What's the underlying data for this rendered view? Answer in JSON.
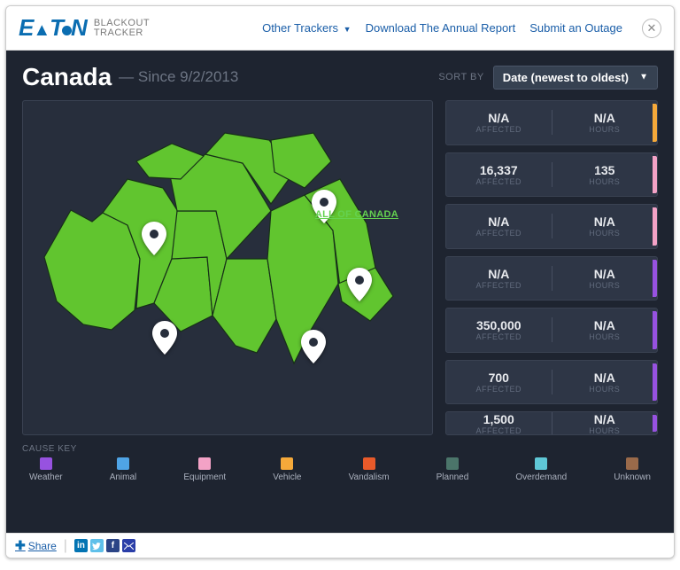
{
  "logo": {
    "brand": "E·T·N",
    "sub_l1": "BLACKOUT",
    "sub_l2": "TRACKER"
  },
  "top_nav": {
    "other_trackers": "Other Trackers",
    "download_report": "Download The Annual Report",
    "submit_outage": "Submit an Outage"
  },
  "page": {
    "title": "Canada",
    "since": "— Since 9/2/2013",
    "all_of_canada": "ALL OF CANADA"
  },
  "sort": {
    "label": "SORT BY",
    "selected": "Date (newest to oldest)"
  },
  "stats": [
    {
      "affected": "N/A",
      "hours": "N/A",
      "color": "#f5a93a"
    },
    {
      "affected": "16,337",
      "hours": "135",
      "color": "#f3a2c6"
    },
    {
      "affected": "N/A",
      "hours": "N/A",
      "color": "#f3a2c6"
    },
    {
      "affected": "N/A",
      "hours": "N/A",
      "color": "#9752e0"
    },
    {
      "affected": "350,000",
      "hours": "N/A",
      "color": "#9752e0"
    },
    {
      "affected": "700",
      "hours": "N/A",
      "color": "#9752e0"
    },
    {
      "affected": "1,500",
      "hours": "N/A",
      "color": "#9752e0"
    }
  ],
  "stat_labels": {
    "affected": "AFFECTED",
    "hours": "HOURS"
  },
  "cause_key": {
    "title": "CAUSE KEY",
    "items": [
      {
        "name": "Weather",
        "color": "#9752e0"
      },
      {
        "name": "Animal",
        "color": "#4fa4e6"
      },
      {
        "name": "Equipment",
        "color": "#f3a2c6"
      },
      {
        "name": "Vehicle",
        "color": "#f5a93a"
      },
      {
        "name": "Vandalism",
        "color": "#e85a2a"
      },
      {
        "name": "Planned",
        "color": "#4b756a"
      },
      {
        "name": "Overdemand",
        "color": "#5fc7d6"
      },
      {
        "name": "Unknown",
        "color": "#9a6a4a"
      }
    ]
  },
  "share": {
    "label": "Share"
  }
}
